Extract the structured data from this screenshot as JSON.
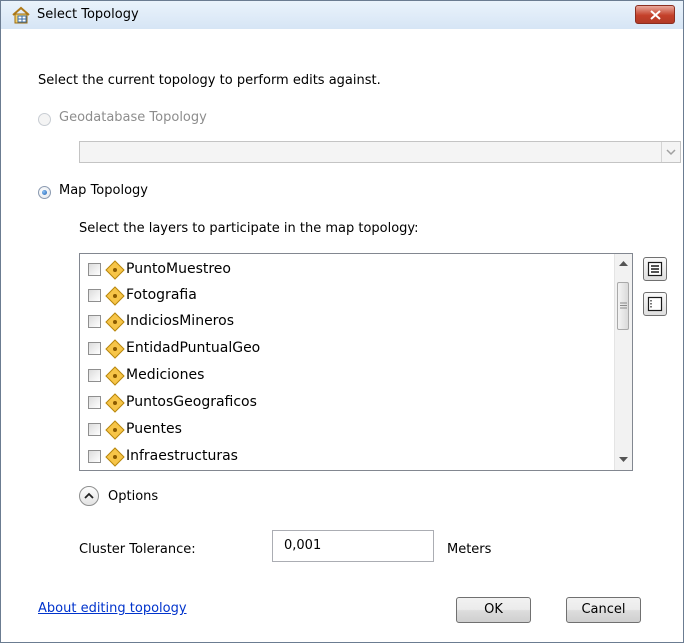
{
  "window": {
    "title": "Select Topology",
    "close_icon": "close-x-icon",
    "app_icon": "topology-icon"
  },
  "instruction": "Select the current topology to perform edits against.",
  "geodatabase_option": {
    "label": "Geodatabase Topology",
    "selected": false,
    "enabled": false,
    "combo_value": ""
  },
  "map_option": {
    "label": "Map Topology",
    "selected": true,
    "layers_prompt": "Select the layers to participate in the map topology:",
    "layers": [
      {
        "name": "PuntoMuestreo",
        "checked": false
      },
      {
        "name": "Fotografia",
        "checked": false
      },
      {
        "name": "IndiciosMineros",
        "checked": false
      },
      {
        "name": "EntidadPuntualGeo",
        "checked": false
      },
      {
        "name": "Mediciones",
        "checked": false
      },
      {
        "name": "PuntosGeograficos",
        "checked": false
      },
      {
        "name": "Puentes",
        "checked": false
      },
      {
        "name": "Infraestructuras",
        "checked": false
      }
    ]
  },
  "side_buttons": {
    "select_all_icon": "select-all-icon",
    "clear_all_icon": "clear-all-icon"
  },
  "options": {
    "label": "Options",
    "expanded": true,
    "cluster_tolerance_label": "Cluster Tolerance:",
    "cluster_tolerance_value": "0,001",
    "units": "Meters"
  },
  "footer": {
    "help_link": "About editing topology",
    "ok_label": "OK",
    "cancel_label": "Cancel"
  },
  "colors": {
    "link": "#0033cc",
    "radio_selected": "#1d5fb0",
    "close_button": "#c4402a",
    "layer_icon_fill": "#f7c548"
  }
}
